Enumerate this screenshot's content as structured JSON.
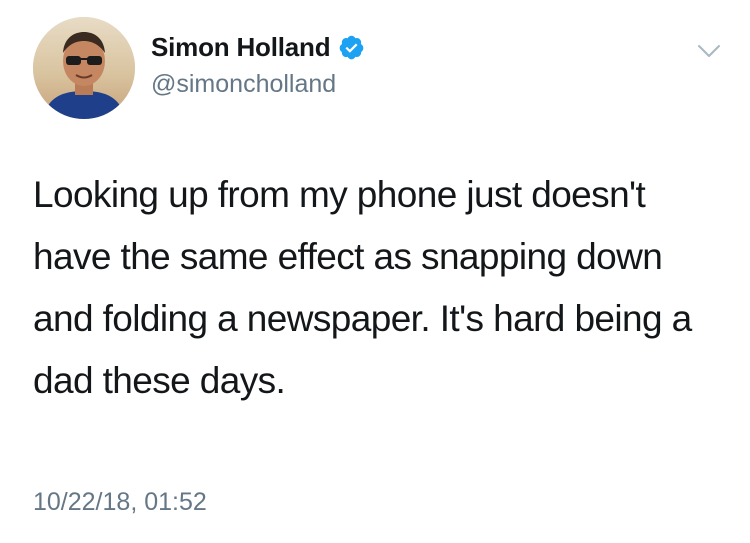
{
  "tweet": {
    "author": {
      "display_name": "Simon Holland",
      "handle": "@simoncholland",
      "verified": true
    },
    "text": "Looking up from my phone just doesn't have the same effect as snapping down and folding a newspaper. It's hard being a dad these days.",
    "timestamp": "10/22/18, 01:52"
  },
  "icons": {
    "verified": "verified-badge-icon",
    "menu": "chevron-down-icon"
  },
  "colors": {
    "text_primary": "#14171a",
    "text_secondary": "#657786",
    "verified_blue": "#1da1f2",
    "background": "#ffffff"
  }
}
